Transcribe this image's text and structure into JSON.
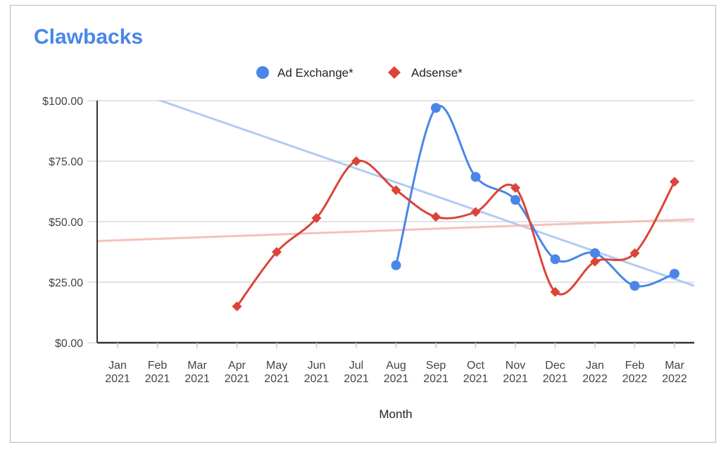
{
  "chart_data": {
    "type": "line",
    "title": "Clawbacks",
    "xlabel": "Month",
    "ylabel": "",
    "ylim": [
      0,
      100
    ],
    "yticks": [
      0,
      25,
      50,
      75,
      100
    ],
    "ytick_labels": [
      "$0.00",
      "$25.00",
      "$50.00",
      "$75.00",
      "$100.00"
    ],
    "grid": true,
    "legend_position": "top",
    "categories": [
      {
        "month": "Jan",
        "year": "2021"
      },
      {
        "month": "Feb",
        "year": "2021"
      },
      {
        "month": "Mar",
        "year": "2021"
      },
      {
        "month": "Apr",
        "year": "2021"
      },
      {
        "month": "May",
        "year": "2021"
      },
      {
        "month": "Jun",
        "year": "2021"
      },
      {
        "month": "Jul",
        "year": "2021"
      },
      {
        "month": "Aug",
        "year": "2021"
      },
      {
        "month": "Sep",
        "year": "2021"
      },
      {
        "month": "Oct",
        "year": "2021"
      },
      {
        "month": "Nov",
        "year": "2021"
      },
      {
        "month": "Dec",
        "year": "2021"
      },
      {
        "month": "Jan",
        "year": "2022"
      },
      {
        "month": "Feb",
        "year": "2022"
      },
      {
        "month": "Mar",
        "year": "2022"
      }
    ],
    "series": [
      {
        "name": "Ad Exchange*",
        "color": "#4a86e8",
        "trend_color": "#a4c2f4",
        "marker": "circle",
        "values": [
          null,
          null,
          null,
          null,
          null,
          null,
          null,
          32,
          97,
          68.5,
          59,
          34.5,
          37,
          23.5,
          28.5
        ],
        "trendline": {
          "start_index": -0.5,
          "start_value": 109,
          "end_index": 14.5,
          "end_value": 23.5
        }
      },
      {
        "name": "Adsense*",
        "color": "#db4437",
        "trend_color": "#f4b7b0",
        "marker": "diamond",
        "values": [
          null,
          null,
          null,
          15,
          37.5,
          51.5,
          75,
          63,
          52,
          54,
          64,
          21,
          33.5,
          37,
          66.5
        ],
        "trendline": {
          "start_index": -0.5,
          "start_value": 42,
          "end_index": 14.5,
          "end_value": 51
        }
      }
    ]
  }
}
